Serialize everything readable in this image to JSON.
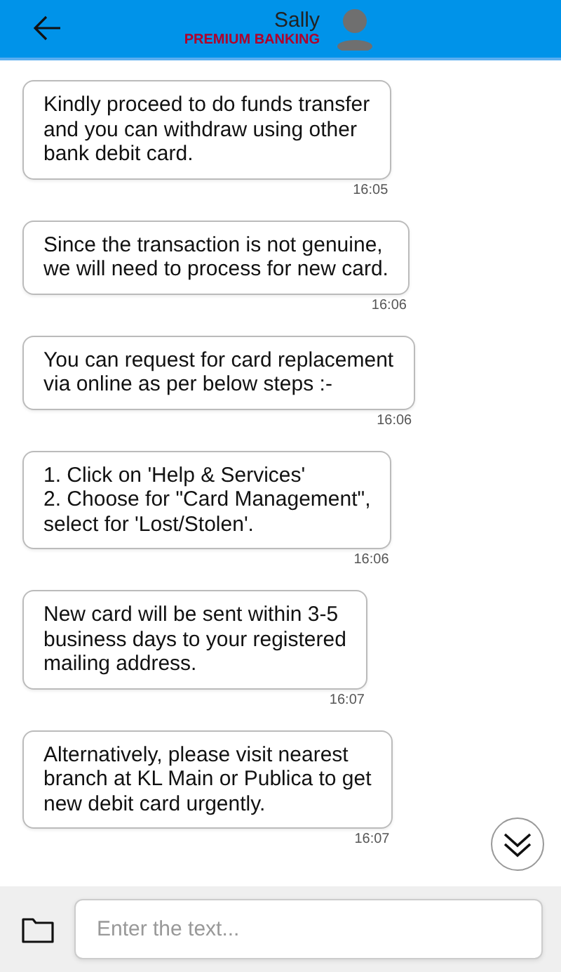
{
  "header": {
    "name": "Sally",
    "subtitle": "PREMIUM BANKING"
  },
  "messages": [
    {
      "text": "Kindly proceed to do funds transfer\nand you can withdraw using other\nbank debit card.",
      "time": "16:05"
    },
    {
      "text": "Since the transaction is not genuine,\nwe will need to process for new card.",
      "time": "16:06"
    },
    {
      "text": "You can request for card replacement\nvia online as per below steps :-",
      "time": "16:06"
    },
    {
      "text": "1. Click on 'Help & Services'\n2. Choose for \"Card Management\",\nselect for 'Lost/Stolen'.",
      "time": "16:06"
    },
    {
      "text": "New card will be sent within 3-5\nbusiness days to your registered\nmailing address.",
      "time": "16:07"
    },
    {
      "text": "Alternatively, please visit nearest\nbranch at KL Main or Publica to get\nnew debit card urgently.",
      "time": "16:07"
    }
  ],
  "composer": {
    "placeholder": "Enter the text..."
  }
}
